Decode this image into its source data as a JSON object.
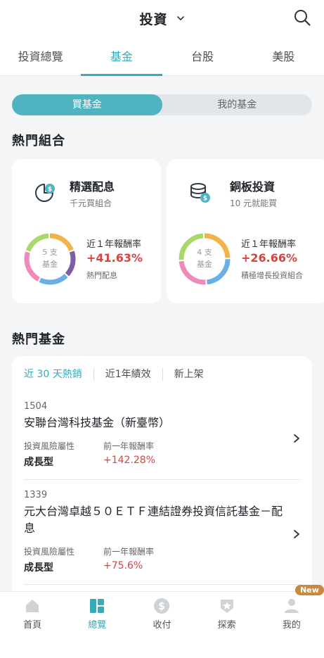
{
  "header": {
    "title": "投資"
  },
  "tabs": [
    {
      "label": "投資總覽"
    },
    {
      "label": "基金"
    },
    {
      "label": "台股"
    },
    {
      "label": "美股"
    }
  ],
  "segment": {
    "buy": "買基金",
    "mine": "我的基金"
  },
  "hot_portfolios": {
    "section_title": "熱門組合",
    "cards": [
      {
        "name": "精選配息",
        "sub": "千元買組合",
        "donut_count": "5 支",
        "donut_unit": "基金",
        "return_label": "近１年報酬率",
        "return_value": "+41.63%",
        "desc": "熱門配息",
        "icon": "pie-chart-dollar-icon"
      },
      {
        "name": "銅板投資",
        "sub": "10 元就能買",
        "donut_count": "4 支",
        "donut_unit": "基金",
        "return_label": "近１年報酬率",
        "return_value": "+26.66%",
        "desc": "積極增長投資組合",
        "icon": "coin-stack-dollar-icon"
      }
    ]
  },
  "hot_funds": {
    "section_title": "熱門基金",
    "sub_tabs": [
      "近 30 天熱銷",
      "近1年績效",
      "新上架"
    ],
    "items": [
      {
        "code": "1504",
        "name": "安聯台灣科技基金（新臺幣）",
        "risk_label": "投資風險屬性",
        "risk_value": "成長型",
        "return_label": "前一年報酬率",
        "return_value": "+142.28%"
      },
      {
        "code": "1339",
        "name": "元大台灣卓越５０ＥＴＦ連結證券投資信託基金－配息",
        "risk_label": "投資風險屬性",
        "risk_value": "成長型",
        "return_label": "前一年報酬率",
        "return_value": "+75.6%"
      }
    ]
  },
  "bottom_nav": [
    {
      "label": "首頁",
      "icon": "home-icon"
    },
    {
      "label": "總覽",
      "icon": "overview-icon"
    },
    {
      "label": "收付",
      "icon": "dollar-icon"
    },
    {
      "label": "探索",
      "icon": "explore-icon"
    },
    {
      "label": "我的",
      "icon": "profile-icon",
      "badge": "New"
    }
  ],
  "colors": {
    "accent": "#3aa9b9",
    "positive": "#d8443f",
    "badge": "#c88a3e",
    "donut": [
      "#f1b44a",
      "#7a5fa6",
      "#6ab0e6",
      "#f08ab9",
      "#a9d96a"
    ]
  }
}
